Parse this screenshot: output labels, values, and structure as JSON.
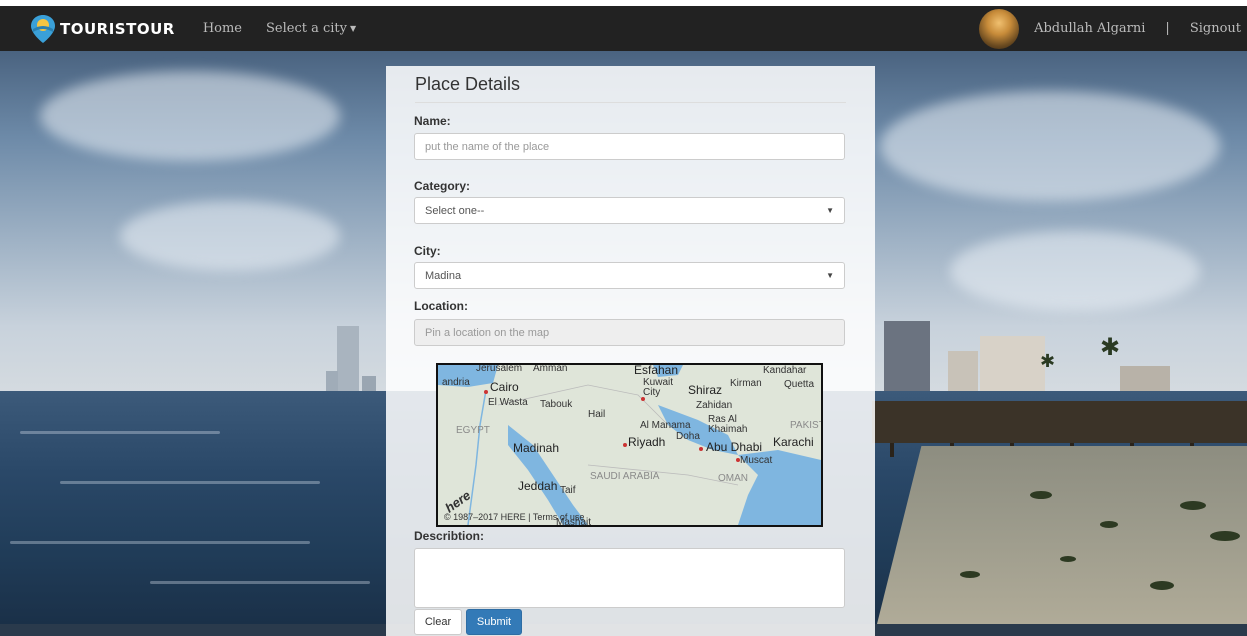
{
  "brand": {
    "name": "TOURISTOUR",
    "icon": "map-pin-sun-icon"
  },
  "nav": {
    "home": "Home",
    "select_city": "Select a city",
    "user_name": "Abdullah Algarni",
    "separator": "|",
    "signout": "Signout"
  },
  "form": {
    "title": "Place Details",
    "name_label": "Name:",
    "name_placeholder": "put the name of the place",
    "category_label": "Category:",
    "category_value": "Select one--",
    "city_label": "City:",
    "city_value": "Madina",
    "location_label": "Location:",
    "location_placeholder": "Pin a location on the map",
    "description_label": "Describtion:",
    "clear_button": "Clear",
    "submit_button": "Submit"
  },
  "map": {
    "labels": [
      "Jerusalem",
      "Amman",
      "Esfahan",
      "Kandahar",
      "andria",
      "Cairo",
      "Kuwait City",
      "Shiraz",
      "Kirman",
      "Quetta",
      "El Wasta",
      "Tabouk",
      "Zahidan",
      "Hail",
      "EGYPT",
      "Al Manama",
      "Ras Al Khaimah",
      "PAKIST",
      "Doha",
      "Riyadh",
      "Abu Dhabi",
      "Karachi",
      "Madinah",
      "Muscat",
      "SAUDI ARABIA",
      "OMAN",
      "Jeddah",
      "Taif",
      "Mashait"
    ],
    "copyright": "© 1987–2017 HERE | Terms of use",
    "logo": "here"
  },
  "colors": {
    "navbar": "#222222",
    "submit": "#337ab7"
  }
}
